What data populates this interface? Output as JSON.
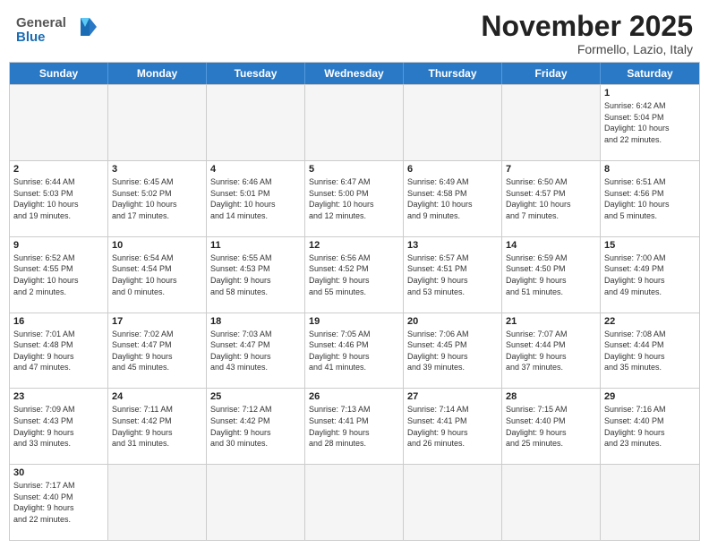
{
  "header": {
    "logo_general": "General",
    "logo_blue": "Blue",
    "month_title": "November 2025",
    "location": "Formello, Lazio, Italy"
  },
  "days_of_week": [
    "Sunday",
    "Monday",
    "Tuesday",
    "Wednesday",
    "Thursday",
    "Friday",
    "Saturday"
  ],
  "weeks": [
    [
      {
        "day": "",
        "info": ""
      },
      {
        "day": "",
        "info": ""
      },
      {
        "day": "",
        "info": ""
      },
      {
        "day": "",
        "info": ""
      },
      {
        "day": "",
        "info": ""
      },
      {
        "day": "",
        "info": ""
      },
      {
        "day": "1",
        "info": "Sunrise: 6:42 AM\nSunset: 5:04 PM\nDaylight: 10 hours\nand 22 minutes."
      }
    ],
    [
      {
        "day": "2",
        "info": "Sunrise: 6:44 AM\nSunset: 5:03 PM\nDaylight: 10 hours\nand 19 minutes."
      },
      {
        "day": "3",
        "info": "Sunrise: 6:45 AM\nSunset: 5:02 PM\nDaylight: 10 hours\nand 17 minutes."
      },
      {
        "day": "4",
        "info": "Sunrise: 6:46 AM\nSunset: 5:01 PM\nDaylight: 10 hours\nand 14 minutes."
      },
      {
        "day": "5",
        "info": "Sunrise: 6:47 AM\nSunset: 5:00 PM\nDaylight: 10 hours\nand 12 minutes."
      },
      {
        "day": "6",
        "info": "Sunrise: 6:49 AM\nSunset: 4:58 PM\nDaylight: 10 hours\nand 9 minutes."
      },
      {
        "day": "7",
        "info": "Sunrise: 6:50 AM\nSunset: 4:57 PM\nDaylight: 10 hours\nand 7 minutes."
      },
      {
        "day": "8",
        "info": "Sunrise: 6:51 AM\nSunset: 4:56 PM\nDaylight: 10 hours\nand 5 minutes."
      }
    ],
    [
      {
        "day": "9",
        "info": "Sunrise: 6:52 AM\nSunset: 4:55 PM\nDaylight: 10 hours\nand 2 minutes."
      },
      {
        "day": "10",
        "info": "Sunrise: 6:54 AM\nSunset: 4:54 PM\nDaylight: 10 hours\nand 0 minutes."
      },
      {
        "day": "11",
        "info": "Sunrise: 6:55 AM\nSunset: 4:53 PM\nDaylight: 9 hours\nand 58 minutes."
      },
      {
        "day": "12",
        "info": "Sunrise: 6:56 AM\nSunset: 4:52 PM\nDaylight: 9 hours\nand 55 minutes."
      },
      {
        "day": "13",
        "info": "Sunrise: 6:57 AM\nSunset: 4:51 PM\nDaylight: 9 hours\nand 53 minutes."
      },
      {
        "day": "14",
        "info": "Sunrise: 6:59 AM\nSunset: 4:50 PM\nDaylight: 9 hours\nand 51 minutes."
      },
      {
        "day": "15",
        "info": "Sunrise: 7:00 AM\nSunset: 4:49 PM\nDaylight: 9 hours\nand 49 minutes."
      }
    ],
    [
      {
        "day": "16",
        "info": "Sunrise: 7:01 AM\nSunset: 4:48 PM\nDaylight: 9 hours\nand 47 minutes."
      },
      {
        "day": "17",
        "info": "Sunrise: 7:02 AM\nSunset: 4:47 PM\nDaylight: 9 hours\nand 45 minutes."
      },
      {
        "day": "18",
        "info": "Sunrise: 7:03 AM\nSunset: 4:47 PM\nDaylight: 9 hours\nand 43 minutes."
      },
      {
        "day": "19",
        "info": "Sunrise: 7:05 AM\nSunset: 4:46 PM\nDaylight: 9 hours\nand 41 minutes."
      },
      {
        "day": "20",
        "info": "Sunrise: 7:06 AM\nSunset: 4:45 PM\nDaylight: 9 hours\nand 39 minutes."
      },
      {
        "day": "21",
        "info": "Sunrise: 7:07 AM\nSunset: 4:44 PM\nDaylight: 9 hours\nand 37 minutes."
      },
      {
        "day": "22",
        "info": "Sunrise: 7:08 AM\nSunset: 4:44 PM\nDaylight: 9 hours\nand 35 minutes."
      }
    ],
    [
      {
        "day": "23",
        "info": "Sunrise: 7:09 AM\nSunset: 4:43 PM\nDaylight: 9 hours\nand 33 minutes."
      },
      {
        "day": "24",
        "info": "Sunrise: 7:11 AM\nSunset: 4:42 PM\nDaylight: 9 hours\nand 31 minutes."
      },
      {
        "day": "25",
        "info": "Sunrise: 7:12 AM\nSunset: 4:42 PM\nDaylight: 9 hours\nand 30 minutes."
      },
      {
        "day": "26",
        "info": "Sunrise: 7:13 AM\nSunset: 4:41 PM\nDaylight: 9 hours\nand 28 minutes."
      },
      {
        "day": "27",
        "info": "Sunrise: 7:14 AM\nSunset: 4:41 PM\nDaylight: 9 hours\nand 26 minutes."
      },
      {
        "day": "28",
        "info": "Sunrise: 7:15 AM\nSunset: 4:40 PM\nDaylight: 9 hours\nand 25 minutes."
      },
      {
        "day": "29",
        "info": "Sunrise: 7:16 AM\nSunset: 4:40 PM\nDaylight: 9 hours\nand 23 minutes."
      }
    ],
    [
      {
        "day": "30",
        "info": "Sunrise: 7:17 AM\nSunset: 4:40 PM\nDaylight: 9 hours\nand 22 minutes."
      },
      {
        "day": "",
        "info": ""
      },
      {
        "day": "",
        "info": ""
      },
      {
        "day": "",
        "info": ""
      },
      {
        "day": "",
        "info": ""
      },
      {
        "day": "",
        "info": ""
      },
      {
        "day": "",
        "info": ""
      }
    ]
  ]
}
